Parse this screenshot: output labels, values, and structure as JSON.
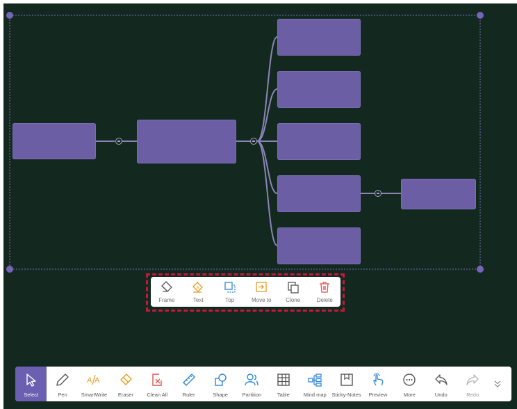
{
  "colors": {
    "board_background": "#13291f",
    "node_fill": "#6c5ea5",
    "connector": "#8c84b8",
    "selection": "#7565b8",
    "highlight": "#c8173b",
    "active_tool": "#6a5fb0",
    "accent_orange": "#e89a1e",
    "accent_blue": "#2f86d6",
    "accent_red": "#e0524a"
  },
  "context_toolbar": {
    "items": [
      {
        "label": "Frame",
        "icon": "frame-icon"
      },
      {
        "label": "Text",
        "icon": "text-color-icon"
      },
      {
        "label": "Top",
        "icon": "bring-to-top-icon"
      },
      {
        "label": "Move to",
        "icon": "move-to-icon"
      },
      {
        "label": "Clone",
        "icon": "clone-icon"
      },
      {
        "label": "Delete",
        "icon": "trash-icon"
      }
    ]
  },
  "main_toolbar": {
    "tools": [
      {
        "label": "Select",
        "icon": "cursor-icon",
        "active": true
      },
      {
        "label": "Pen",
        "icon": "pen-icon"
      },
      {
        "label": "SmartWrite",
        "icon": "smartwrite-icon"
      },
      {
        "label": "Eraser",
        "icon": "eraser-icon"
      },
      {
        "label": "Clean All",
        "icon": "clean-all-icon"
      },
      {
        "label": "Ruler",
        "icon": "ruler-icon"
      },
      {
        "label": "Shape",
        "icon": "shape-icon"
      },
      {
        "label": "Partition",
        "icon": "partition-icon"
      },
      {
        "label": "Table",
        "icon": "table-icon"
      },
      {
        "label": "Mind map",
        "icon": "mind-map-icon"
      },
      {
        "label": "Sticky-Notes",
        "icon": "sticky-note-icon"
      },
      {
        "label": "Preview",
        "icon": "preview-hand-icon"
      },
      {
        "label": "More",
        "icon": "more-icon"
      },
      {
        "label": "Undo",
        "icon": "undo-icon"
      },
      {
        "label": "Redo",
        "icon": "redo-icon",
        "disabled": true
      }
    ],
    "expand_icon": "chevron-double-down-icon"
  }
}
